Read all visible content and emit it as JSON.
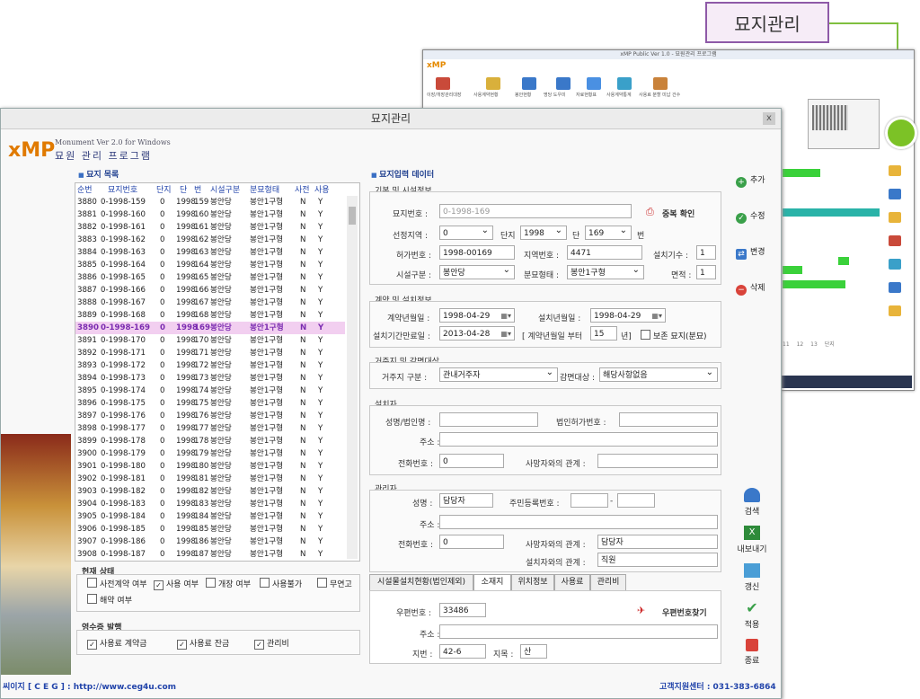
{
  "callout": {
    "label": "묘지관리"
  },
  "bgwin": {
    "title": "xMP Public Ver 1.0 - 묘원관리 프로그램",
    "brand": "xMP",
    "toolbar": [
      "이장/개장관리대장",
      "사용계약현황",
      "봉안현황",
      "명당 도우미",
      "자료현황표",
      "사용계약통계",
      "사용료 분할 미납 건수"
    ],
    "page_controls": [
      "11",
      "12",
      "13",
      "단지"
    ]
  },
  "main": {
    "title": "묘지관리",
    "close": "x",
    "logo": {
      "brand": "xMP",
      "sub1": "Monument Ver 2.0 for Windows",
      "sub2": "묘원 관리 프로그램"
    },
    "list_title": "묘지 목록",
    "columns": [
      "순번",
      "묘지번호",
      "단지",
      "단",
      "번",
      "시설구분",
      "분묘형태",
      "사전",
      "사용"
    ],
    "rows": [
      [
        "3880",
        "0-1998-159",
        "0",
        "1998",
        "159",
        "봉안당",
        "봉안1구형",
        "N",
        "Y"
      ],
      [
        "3881",
        "0-1998-160",
        "0",
        "1998",
        "160",
        "봉안당",
        "봉안1구형",
        "N",
        "Y"
      ],
      [
        "3882",
        "0-1998-161",
        "0",
        "1998",
        "161",
        "봉안당",
        "봉안1구형",
        "N",
        "Y"
      ],
      [
        "3883",
        "0-1998-162",
        "0",
        "1998",
        "162",
        "봉안당",
        "봉안1구형",
        "N",
        "Y"
      ],
      [
        "3884",
        "0-1998-163",
        "0",
        "1998",
        "163",
        "봉안당",
        "봉안1구형",
        "N",
        "Y"
      ],
      [
        "3885",
        "0-1998-164",
        "0",
        "1998",
        "164",
        "봉안당",
        "봉안1구형",
        "N",
        "Y"
      ],
      [
        "3886",
        "0-1998-165",
        "0",
        "1998",
        "165",
        "봉안당",
        "봉안1구형",
        "N",
        "Y"
      ],
      [
        "3887",
        "0-1998-166",
        "0",
        "1998",
        "166",
        "봉안당",
        "봉안1구형",
        "N",
        "Y"
      ],
      [
        "3888",
        "0-1998-167",
        "0",
        "1998",
        "167",
        "봉안당",
        "봉안1구형",
        "N",
        "Y"
      ],
      [
        "3889",
        "0-1998-168",
        "0",
        "1998",
        "168",
        "봉안당",
        "봉안1구형",
        "N",
        "Y"
      ],
      [
        "3890",
        "0-1998-169",
        "0",
        "1998",
        "169",
        "봉안당",
        "봉안1구형",
        "N",
        "Y"
      ],
      [
        "3891",
        "0-1998-170",
        "0",
        "1998",
        "170",
        "봉안당",
        "봉안1구형",
        "N",
        "Y"
      ],
      [
        "3892",
        "0-1998-171",
        "0",
        "1998",
        "171",
        "봉안당",
        "봉안1구형",
        "N",
        "Y"
      ],
      [
        "3893",
        "0-1998-172",
        "0",
        "1998",
        "172",
        "봉안당",
        "봉안1구형",
        "N",
        "Y"
      ],
      [
        "3894",
        "0-1998-173",
        "0",
        "1998",
        "173",
        "봉안당",
        "봉안1구형",
        "N",
        "Y"
      ],
      [
        "3895",
        "0-1998-174",
        "0",
        "1998",
        "174",
        "봉안당",
        "봉안1구형",
        "N",
        "Y"
      ],
      [
        "3896",
        "0-1998-175",
        "0",
        "1998",
        "175",
        "봉안당",
        "봉안1구형",
        "N",
        "Y"
      ],
      [
        "3897",
        "0-1998-176",
        "0",
        "1998",
        "176",
        "봉안당",
        "봉안1구형",
        "N",
        "Y"
      ],
      [
        "3898",
        "0-1998-177",
        "0",
        "1998",
        "177",
        "봉안당",
        "봉안1구형",
        "N",
        "Y"
      ],
      [
        "3899",
        "0-1998-178",
        "0",
        "1998",
        "178",
        "봉안당",
        "봉안1구형",
        "N",
        "Y"
      ],
      [
        "3900",
        "0-1998-179",
        "0",
        "1998",
        "179",
        "봉안당",
        "봉안1구형",
        "N",
        "Y"
      ],
      [
        "3901",
        "0-1998-180",
        "0",
        "1998",
        "180",
        "봉안당",
        "봉안1구형",
        "N",
        "Y"
      ],
      [
        "3902",
        "0-1998-181",
        "0",
        "1998",
        "181",
        "봉안당",
        "봉안1구형",
        "N",
        "Y"
      ],
      [
        "3903",
        "0-1998-182",
        "0",
        "1998",
        "182",
        "봉안당",
        "봉안1구형",
        "N",
        "Y"
      ],
      [
        "3904",
        "0-1998-183",
        "0",
        "1998",
        "183",
        "봉안당",
        "봉안1구형",
        "N",
        "Y"
      ],
      [
        "3905",
        "0-1998-184",
        "0",
        "1998",
        "184",
        "봉안당",
        "봉안1구형",
        "N",
        "Y"
      ],
      [
        "3906",
        "0-1998-185",
        "0",
        "1998",
        "185",
        "봉안당",
        "봉안1구형",
        "N",
        "Y"
      ],
      [
        "3907",
        "0-1998-186",
        "0",
        "1998",
        "186",
        "봉안당",
        "봉안1구형",
        "N",
        "Y"
      ],
      [
        "3908",
        "0-1998-187",
        "0",
        "1998",
        "187",
        "봉안당",
        "봉안1구형",
        "N",
        "Y"
      ]
    ],
    "status": {
      "title": "현재 상태",
      "items": [
        {
          "label": "사전계약 여부",
          "checked": false
        },
        {
          "label": "사용 여부",
          "checked": true
        },
        {
          "label": "개장 여부",
          "checked": false
        },
        {
          "label": "사용불가",
          "checked": false
        },
        {
          "label": "무연고",
          "checked": false
        },
        {
          "label": "해약 여부",
          "checked": false
        }
      ]
    },
    "receipt": {
      "title": "영수증 발행",
      "items": [
        {
          "label": "사용료 계약금",
          "checked": true
        },
        {
          "label": "사용료 잔금",
          "checked": true
        },
        {
          "label": "관리비",
          "checked": true
        }
      ]
    },
    "form_title": "묘지입력 데이터",
    "basic": {
      "title": "기본 및 시설정보",
      "grave_no_label": "묘지번호 :",
      "grave_no": "0-1998-169",
      "dup_check": "중복 확인",
      "region_label": "선정지역 :",
      "region": "0",
      "danji_label": "단지",
      "danji": "1998",
      "dan_label": "단",
      "dan": "169",
      "beon_label": "번",
      "permit_label": "허가번호 :",
      "permit": "1998-00169",
      "lot_label": "지역번호 :",
      "lot": "4471",
      "count_label": "설치기수 :",
      "count": "1",
      "facility_label": "시설구분 :",
      "facility": "봉안당",
      "shape_label": "분묘형태 :",
      "shape": "봉안1구형",
      "area_label": "면적 :",
      "area": "1"
    },
    "contract": {
      "title": "계약 및 설치정보",
      "contract_date_label": "계약년월일 :",
      "contract_date": "1998-04-29",
      "install_date_label": "설치년월일 :",
      "install_date": "1998-04-29",
      "expiry_label": "설치기간만료일 :",
      "expiry": "2013-04-28",
      "from_label": "[ 계약년월일 부터",
      "years": "15",
      "years_unit": "년]",
      "keep_label": "보존 묘지(분묘)"
    },
    "residence": {
      "title": "거주지 및 감면대상",
      "type_label": "거주지 구분 :",
      "type": "관내거주자",
      "reduce_label": "감면대상 :",
      "reduce": "해당사항없음"
    },
    "installer": {
      "title": "설치자",
      "name_label": "성명/법인명 :",
      "corp_label": "법인허가번호 :",
      "addr_label": "주소 :",
      "phone_label": "전화번호 :",
      "phone": "0",
      "relation_label": "사망자와의 관계 :"
    },
    "manager": {
      "title": "관리자",
      "name_label": "성명 :",
      "name": "담당자",
      "rrn_label": "주민등록번호 :",
      "addr_label": "주소 :",
      "phone_label": "전화번호 :",
      "phone": "0",
      "relation1_label": "사망자와의 관계 :",
      "relation1": "담당자",
      "relation2_label": "설치자와의 관계 :",
      "relation2": "직원"
    },
    "tabs": [
      "시설물설치현황(법인제외)",
      "소재지",
      "위치정보",
      "사용료",
      "관리비"
    ],
    "location": {
      "zip_label": "우편번호 :",
      "zip": "33486",
      "zip_search": "우편번호찾기",
      "addr_label": "주소 :",
      "jibun_label": "지번 :",
      "jibun": "42-6",
      "jimok_label": "지목 :",
      "jimok": "산"
    },
    "actions": {
      "add": "추가",
      "edit": "수정",
      "change": "변경",
      "delete": "삭제"
    },
    "side": {
      "search": "검색",
      "export": "내보내기",
      "refresh": "갱신",
      "apply": "적용",
      "exit": "종료"
    },
    "footer_left": "씨이지 [ C E G ] : http://www.ceg4u.com",
    "footer_right": "고객지원센터 : 031-383-6864"
  }
}
